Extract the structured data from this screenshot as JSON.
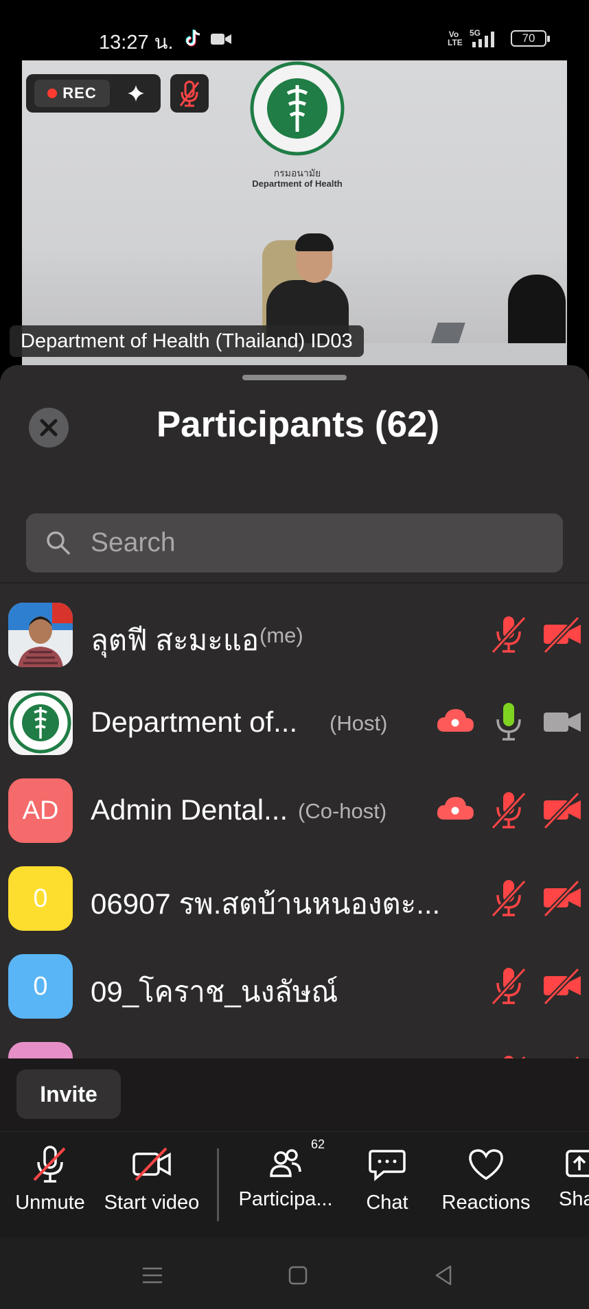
{
  "status_bar": {
    "time": "13:27 น.",
    "network_label": "Vo LTE",
    "signal_label": "5G",
    "battery": "70"
  },
  "video": {
    "rec_label": "REC",
    "speaker_name": "Department of Health (Thailand) ID03",
    "backdrop_logo_th": "กรมอนามัย",
    "backdrop_logo_en": "Department of Health"
  },
  "sheet": {
    "title": "Participants (62)",
    "search_placeholder": "Search"
  },
  "participants": [
    {
      "name": "ลุตฟี สะมะแอ",
      "role": "(me)",
      "avatar": "photo",
      "mic": "muted",
      "video": "off",
      "cloud": false
    },
    {
      "name": "Department of...",
      "role": "(Host)",
      "avatar": "seal",
      "mic": "on",
      "video": "on",
      "cloud": true
    },
    {
      "name": "Admin Dental...",
      "role": "(Co-host)",
      "avatar_text": "AD",
      "avatar_color": "#f56a6a",
      "mic": "muted",
      "video": "off",
      "cloud": true
    },
    {
      "name": "06907 รพ.สตบ้านหนองตะ...",
      "role": "",
      "avatar_text": "0",
      "avatar_color": "#fddd2e",
      "mic": "muted",
      "video": "off",
      "cloud": false
    },
    {
      "name": "09_โคราช_นงลัษณ์",
      "role": "",
      "avatar_text": "0",
      "avatar_color": "#5ab5f6",
      "mic": "muted",
      "video": "off",
      "cloud": false
    },
    {
      "name": "",
      "role": "",
      "avatar_text": "",
      "avatar_color": "#e68fc7",
      "mic": "muted",
      "video": "off",
      "cloud": false
    }
  ],
  "invite_label": "Invite",
  "toolbar": {
    "unmute": "Unmute",
    "start_video": "Start video",
    "participants": "Participa...",
    "participants_count": "62",
    "chat": "Chat",
    "reactions": "Reactions",
    "share": "Sha"
  },
  "colors": {
    "sheet_bg": "#2c2a2b",
    "muted_red": "#ff4545",
    "mic_on_green": "#7ed321",
    "cloud_red": "#ff5a5a"
  }
}
